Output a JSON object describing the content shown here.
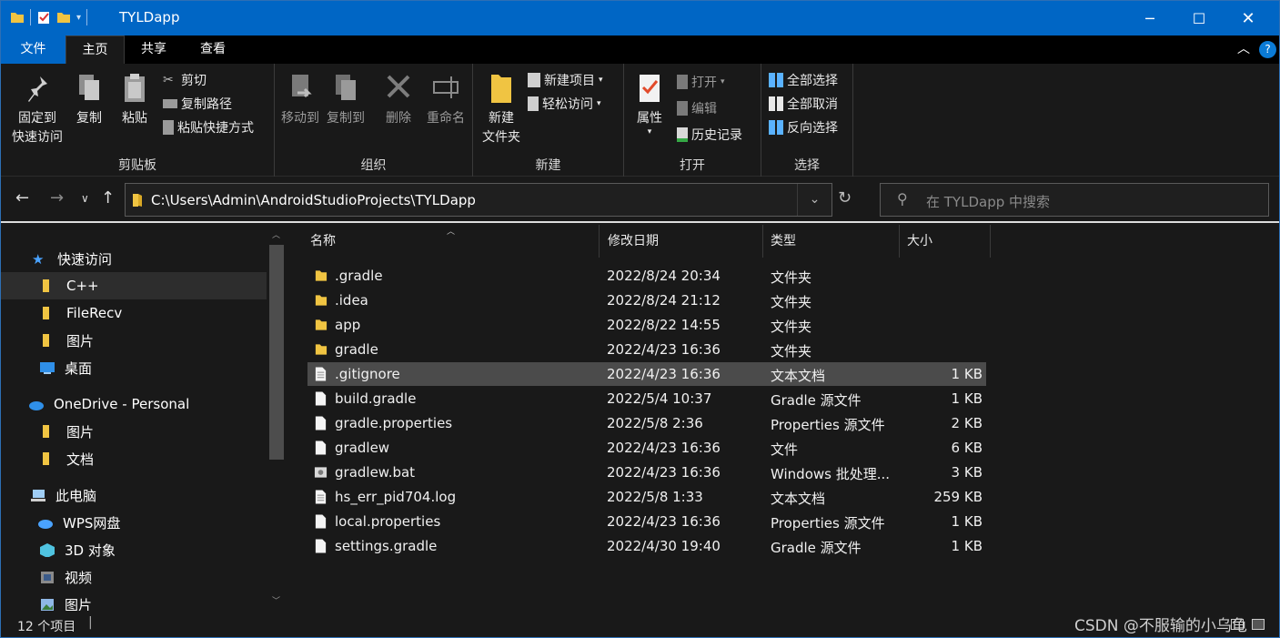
{
  "window": {
    "title": "TYLDapp"
  },
  "tabs": [
    {
      "label": "文件"
    },
    {
      "label": "主页"
    },
    {
      "label": "共享"
    },
    {
      "label": "查看"
    }
  ],
  "ribbon": {
    "clipboard": {
      "pin_line1": "固定到",
      "pin_line2": "快速访问",
      "copy": "复制",
      "paste": "粘贴",
      "cut": "剪切",
      "copy_path": "复制路径",
      "paste_shortcut": "粘贴快捷方式",
      "label": "剪贴板"
    },
    "organize": {
      "move_to": "移动到",
      "copy_to": "复制到",
      "delete": "删除",
      "rename": "重命名",
      "label": "组织"
    },
    "new": {
      "new_line1": "新建",
      "new_line2": "文件夹",
      "new_item": "新建项目",
      "easy_access": "轻松访问",
      "label": "新建"
    },
    "open": {
      "properties": "属性",
      "open": "打开",
      "edit": "编辑",
      "history": "历史记录",
      "label": "打开"
    },
    "select": {
      "select_all": "全部选择",
      "select_none": "全部取消",
      "invert": "反向选择",
      "label": "选择"
    }
  },
  "address": {
    "path": "C:\\Users\\Admin\\AndroidStudioProjects\\TYLDapp"
  },
  "search": {
    "placeholder": "在 TYLDapp 中搜索"
  },
  "nav": [
    {
      "label": "快速访问",
      "icon": "star-icon"
    },
    {
      "label": "C++",
      "icon": "folder-icon"
    },
    {
      "label": "FileRecv",
      "icon": "folder-icon"
    },
    {
      "label": "图片",
      "icon": "folder-icon"
    },
    {
      "label": "桌面",
      "icon": "desktop-icon"
    },
    {
      "label": "OneDrive - Personal",
      "icon": "cloud-icon"
    },
    {
      "label": "图片",
      "icon": "folder-icon"
    },
    {
      "label": "文档",
      "icon": "folder-icon"
    },
    {
      "label": "此电脑",
      "icon": "computer-icon"
    },
    {
      "label": "WPS网盘",
      "icon": "cloud-icon"
    },
    {
      "label": "3D 对象",
      "icon": "cube-icon"
    },
    {
      "label": "视频",
      "icon": "video-icon"
    },
    {
      "label": "图片",
      "icon": "pictures-icon"
    }
  ],
  "columns": {
    "name": "名称",
    "date": "修改日期",
    "type": "类型",
    "size": "大小"
  },
  "files": [
    {
      "name": ".gradle",
      "date": "2022/8/24 20:34",
      "type": "文件夹",
      "size": "",
      "icon": "folder-icon"
    },
    {
      "name": ".idea",
      "date": "2022/8/24 21:12",
      "type": "文件夹",
      "size": "",
      "icon": "folder-icon"
    },
    {
      "name": "app",
      "date": "2022/8/22 14:55",
      "type": "文件夹",
      "size": "",
      "icon": "folder-icon"
    },
    {
      "name": "gradle",
      "date": "2022/4/23 16:36",
      "type": "文件夹",
      "size": "",
      "icon": "folder-icon"
    },
    {
      "name": ".gitignore",
      "date": "2022/4/23 16:36",
      "type": "文本文档",
      "size": "1 KB",
      "icon": "text-file-icon"
    },
    {
      "name": "build.gradle",
      "date": "2022/5/4 10:37",
      "type": "Gradle 源文件",
      "size": "1 KB",
      "icon": "file-icon"
    },
    {
      "name": "gradle.properties",
      "date": "2022/5/8 2:36",
      "type": "Properties 源文件",
      "size": "2 KB",
      "icon": "file-icon"
    },
    {
      "name": "gradlew",
      "date": "2022/4/23 16:36",
      "type": "文件",
      "size": "6 KB",
      "icon": "file-icon"
    },
    {
      "name": "gradlew.bat",
      "date": "2022/4/23 16:36",
      "type": "Windows 批处理...",
      "size": "3 KB",
      "icon": "batch-file-icon"
    },
    {
      "name": "hs_err_pid704.log",
      "date": "2022/5/8 1:33",
      "type": "文本文档",
      "size": "259 KB",
      "icon": "text-file-icon"
    },
    {
      "name": "local.properties",
      "date": "2022/4/23 16:36",
      "type": "Properties 源文件",
      "size": "1 KB",
      "icon": "file-icon"
    },
    {
      "name": "settings.gradle",
      "date": "2022/4/30 19:40",
      "type": "Gradle 源文件",
      "size": "1 KB",
      "icon": "file-icon"
    }
  ],
  "status": {
    "count": "12 个项目",
    "watermark": "CSDN @不服输的小乌龟"
  }
}
